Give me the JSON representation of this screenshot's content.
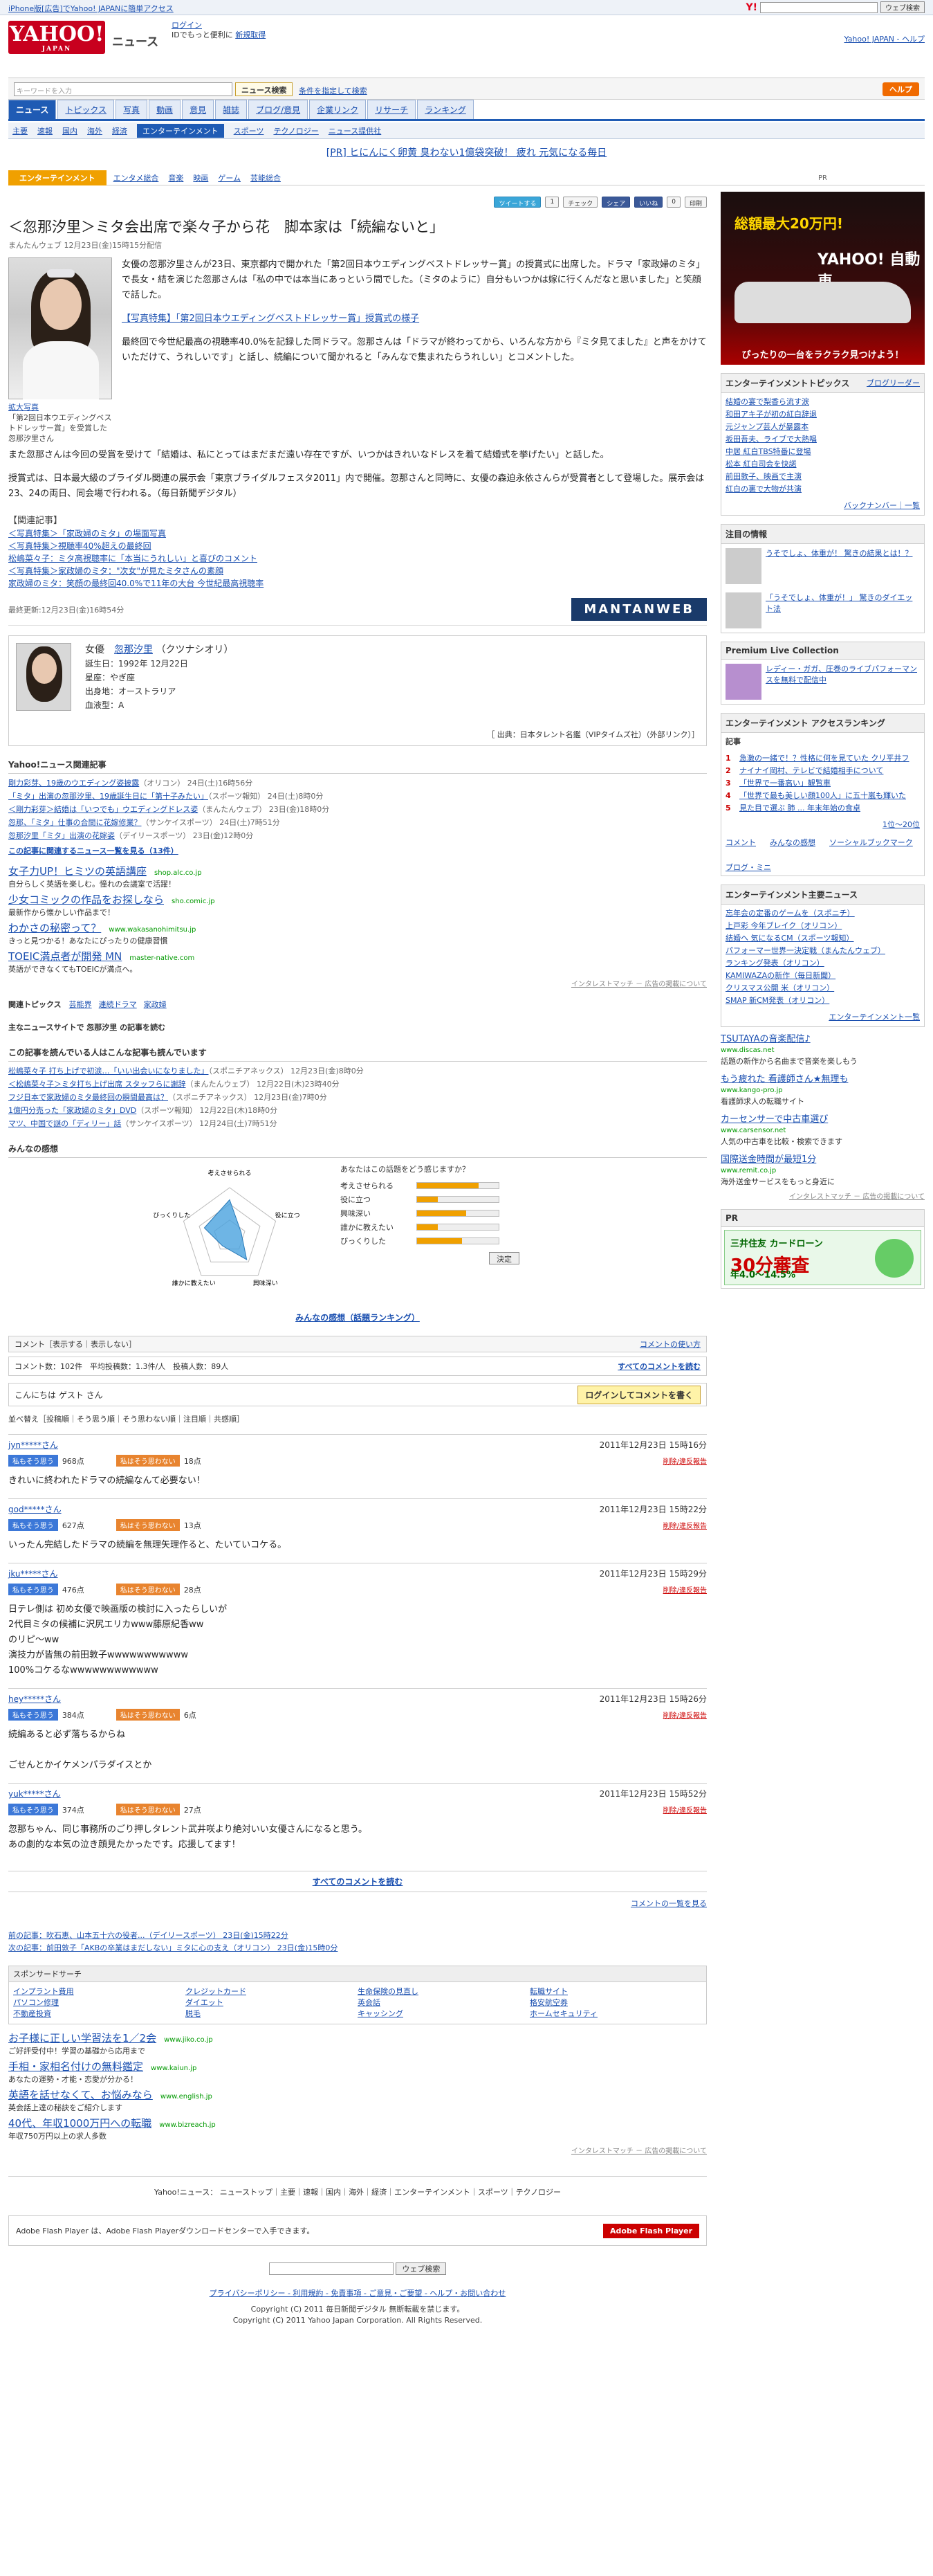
{
  "topstrip": {
    "text": "iPhone版[広告]でYahoo! JAPANに簡単アクセス",
    "search_btn": "ウェブ検索"
  },
  "masthead": {
    "logo": "YAHOO!",
    "logo_sub": "JAPAN",
    "service": "ニュース",
    "login": "ログイン",
    "login_sub": "IDでもっと便利に",
    "signup": "新規取得",
    "links": "Yahoo! JAPAN - ヘルプ"
  },
  "search": {
    "placeholder": "キーワードを入力",
    "button": "ニュース検索",
    "option": "条件を指定して検索",
    "help": "ヘルプ"
  },
  "nav1": [
    "ニュース",
    "トピックス",
    "写真",
    "動画",
    "意見",
    "雑誌",
    "ブログ/意見",
    "企業リンク",
    "リサーチ",
    "ランキング"
  ],
  "nav2": [
    "主要",
    "速報",
    "国内",
    "海外",
    "経済",
    "エンターテインメント",
    "スポーツ",
    "テクノロジー",
    "ニュース提供社"
  ],
  "pr": "[PR] ヒにんにく卵黄 臭わない1億袋突破！ 疲れ 元気になる毎日",
  "catbar": {
    "label": "エンターテインメント",
    "items": [
      "エンタメ総合",
      "音楽",
      "映画",
      "ゲーム",
      "芸能総合"
    ]
  },
  "social": {
    "tweet": "ツイートする",
    "count": "1",
    "check": "チェック",
    "share": "シェア",
    "like": "いいね",
    "count2": "0",
    "print": "印刷"
  },
  "article": {
    "headline": "＜忽那汐里＞ミタ会出席で楽々子から花　脚本家は「続編ないと」",
    "source": "まんたんウェブ 12月23日(金)15時15分配信",
    "photo_caption": "拡大写真",
    "photo_desc": "「第2回日本ウエディングベストドレッサー賞」を受賞した忽那汐里さん",
    "para1": "女優の忽那汐里さんが23日、東京都内で開かれた「第2回日本ウエディングベストドレッサー賞」の授賞式に出席した。ドラマ「家政婦のミタ」で長女・結を演じた忽那さんは「私の中では本当にあっという間でした。（ミタのように）自分もいつかは嫁に行くんだなと思いました」と笑顔で話した。",
    "link1": "【写真特集】「第2回日本ウエディングベストドレッサー賞」授賞式の様子",
    "para2": "最終回で今世紀最高の視聴率40.0%を記録した同ドラマ。忽那さんは「ドラマが終わってから、いろんな方から『ミタ見てました』と声をかけていただけて、うれしいです」と話し、続編について聞かれると「みんなで集まれたらうれしい」とコメントした。",
    "para3": "また忽那さんは今回の受賞を受けて「結婚は、私にとってはまだまだ遠い存在ですが、いつかはきれいなドレスを着て結婚式を挙げたい」と話した。",
    "para4": "授賞式は、日本最大級のブライダル関連の展示会「東京ブライダルフェスタ2011」内で開催。忽那さんと同時に、女優の森迫永依さんらが受賞者として登場した。展示会は23、24の両日、同会場で行われる。（毎日新聞デジタル）",
    "related_title": "【関連記事】",
    "related": [
      "＜写真特集＞「家政婦のミタ」の場面写真",
      "＜写真特集＞視聴率40%超えの最終回",
      "松嶋菜々子：ミタ高視聴率に「本当にうれしい」と喜びのコメント",
      "＜写真特集＞家政婦のミタ：\"次女\"が見たミタさんの素顔",
      "家政婦のミタ：笑顔の最終回40.0%で11年の大台 今世紀最高視聴率"
    ],
    "lastupd": "最終更新:12月23日(金)16時54分",
    "mantan": "MANTANWEB"
  },
  "profile": {
    "type": "女優",
    "name": "忽那汐里",
    "kana": "（クツナシオリ）",
    "birth": "誕生日：1992年 12月22日",
    "sign": "星座：やぎ座",
    "from": "出身地：オーストラリア",
    "blood": "血液型：A",
    "foot": "［ 出典：日本タレント名鑑（VIPタイムズ社）（外部リンク）］"
  },
  "yahoo_related": {
    "title": "Yahoo!ニュース関連記事",
    "items": [
      {
        "t": "剛力彩芽、19歳のウエディング姿披露",
        "d": "（オリコン） 24日(土)16時56分"
      },
      {
        "t": "「ミタ」出演の忽那汐里、19歳誕生日に「第十子みたい」",
        "d": "（スポーツ報知） 24日(土)8時0分"
      },
      {
        "t": "＜剛力彩芽＞結婚は「いつでも」ウエディングドレス姿",
        "d": "（まんたんウェブ） 23日(金)18時0分"
      },
      {
        "t": "忽那、「ミタ」仕事の合間に花嫁修業？",
        "d": "（サンケイスポーツ） 24日(土)7時51分"
      },
      {
        "t": "忽那汐里「ミタ」出演の花嫁姿",
        "d": "（デイリースポーツ） 23日(金)12時0分"
      }
    ],
    "more": "この記事に関連するニュース一覧を見る（13件）"
  },
  "ads1": [
    {
      "t": "女子力UP！ヒミツの英語講座",
      "u": "shop.alc.co.jp",
      "d": "自分らしく英語を楽しむ。憧れの会議室で活躍！"
    },
    {
      "t": "少女コミックの作品をお探しなら",
      "u": "sho.comic.jp",
      "d": "最新作から懐かしい作品まで！"
    },
    {
      "t": "わかさの秘密って？",
      "u": "www.wakasanohimitsu.jp",
      "d": "きっと見つかる！あなたにぴったりの健康習慣"
    },
    {
      "t": "TOEIC満点者が開発 MN",
      "u": "master-native.com",
      "d": "英語ができなくてもTOEICが満点へ。"
    }
  ],
  "adnote": "インタレストマッチ － 広告の掲載について",
  "topics": {
    "label": "関連トピックス",
    "items": [
      "芸能界",
      "連続ドラマ",
      "家政婦"
    ]
  },
  "mainnews": "主なニュースサイトで 忽那汐里 の記事を読む",
  "alsoread": {
    "title": "この記事を読んでいる人はこんな記事も読んでいます",
    "items": [
      {
        "t": "松嶋菜々子 打ち上げで初涙…「いい出会いになりました」",
        "d": "（スポニチアネックス） 12月23日(金)8時0分"
      },
      {
        "t": "＜松嶋菜々子＞ミタ打ち上げ出席 スタッフらに謝辞",
        "d": "（まんたんウェブ） 12月22日(木)23時40分"
      },
      {
        "t": "フジ日本で家政婦のミタ最終回の瞬間最高は？",
        "d": "（スポニチアネックス） 12月23日(金)7時0分"
      },
      {
        "t": "1億円分売った「家政婦のミタ」DVD",
        "d": "（スポーツ報知） 12月22日(木)18時0分"
      },
      {
        "t": "マツ、中国で謎の「ディリー」話",
        "d": "（サンケイスポーツ） 12月24日(土)7時51分"
      }
    ]
  },
  "vote": {
    "title": "みんなの感想",
    "q": "あなたはこの話題をどう感じますか？",
    "axes": [
      "考えさせられる",
      "役に立つ",
      "興味深い",
      "誰かに教えたい",
      "びっくりした"
    ],
    "vals": [
      0.75,
      0.25,
      0.6,
      0.25,
      0.55
    ],
    "btn": "決定",
    "more": "みんなの感想（話題ランキング）"
  },
  "comments": {
    "bar_l": "コメント［表示する｜表示しない］",
    "bar_r": "コメントの使い方",
    "stat": "コメント数：102件　平均投稿数：1.3件/人　投稿人数：89人",
    "stat_r": "すべてのコメントを読む",
    "guest": "こんにちは ゲスト さん",
    "login": "ログインしてコメントを書く",
    "sort": "並べ替え［投稿順｜そう思う順｜そう思わない順｜注目順｜共感順］",
    "list": [
      {
        "u": "jyn*****さん",
        "d": "2011年12月23日 15時16分",
        "p": "968点",
        "n": "18点",
        "b": "きれいに終われたドラマの続編なんて必要ない！"
      },
      {
        "u": "god*****さん",
        "d": "2011年12月23日 15時22分",
        "p": "627点",
        "n": "13点",
        "b": "いったん完結したドラマの続編を無理矢理作ると、たいていコケる。"
      },
      {
        "u": "jku*****さん",
        "d": "2011年12月23日 15時29分",
        "p": "476点",
        "n": "28点",
        "b": "日テレ側は 初め女優で映画版の検討に入ったらしいが\n2代目ミタの候補に沢尻エリカwww藤原紀香ww\nのリピ〜ww\n演技力が皆無の前田敦子wwwwwwwwwww\n100%コケるなwwwwwwwwwwww"
      },
      {
        "u": "hey*****さん",
        "d": "2011年12月23日 15時26分",
        "p": "384点",
        "n": "6点",
        "b": "続編あると必ず落ちるからね\n\nごせんとかイケメンパラダイスとか"
      },
      {
        "u": "yuk*****さん",
        "d": "2011年12月23日 15時52分",
        "p": "374点",
        "n": "27点",
        "b": "忽那ちゃん、同じ事務所のごり押しタレント武井咲より絶対いい女優さんになると思う。\nあの劇的な本気の泣き顔見たかったです。応援してます！"
      }
    ],
    "vp": "私もそう思う",
    "vn": "私はそう思わない",
    "rp": "削除/違反報告",
    "all": "すべてのコメントを読む",
    "more": "コメントの一覧を見る"
  },
  "prevnext": {
    "prev": "前の記事：吹石恵、山本五十六の役者...（デイリースポーツ） 23日(金)15時22分",
    "next": "次の記事：前田敦子「AKBの卒業はまだしない」ミタに心の支え（オリコン） 23日(金)15時0分"
  },
  "sponsor": {
    "title": "スポンサードサーチ",
    "items": [
      "インプラント費用",
      "クレジットカード",
      "生命保険の見直し",
      "転職サイト",
      "パソコン修理",
      "ダイエット",
      "英会話",
      "格安航空券",
      "不動産投資",
      "脱毛",
      "キャッシング",
      "ホームセキュリティ"
    ]
  },
  "ads2": [
    {
      "t": "お子様に正しい学習法を1／2会",
      "u": "www.jiko.co.jp",
      "d": "ご好評受付中！学習の基礎から応用まで"
    },
    {
      "t": "手相・家相名付けの無料鑑定",
      "u": "www.kaiun.jp",
      "d": "あなたの運勢・才能・恋愛が分かる！"
    },
    {
      "t": "英語を話せなくて、お悩みなら",
      "u": "www.english.jp",
      "d": "英会話上達の秘訣をご紹介します"
    },
    {
      "t": "40代、年収1000万円への転職",
      "u": "www.bizreach.jp",
      "d": "年収750万円以上の求人多数"
    }
  ],
  "footnav": "Yahoo!ニュース： ニューストップ｜主要｜速報｜国内｜海外｜経済｜エンターテインメント｜スポーツ｜テクノロジー",
  "flash": {
    "text": "Adobe Flash Player は、Adobe Flash Playerダウンロードセンターで入手できます。",
    "btn": "Adobe Flash Player"
  },
  "btmsearch": "ウェブ検索",
  "footlinks": "プライバシーポリシー - 利用規約 - 免責事項 - ご意見・ご要望 - ヘルプ・お問い合わせ",
  "copy1": "Copyright (C) 2011 毎日新聞デジタル 無断転載を禁じます。",
  "copy2": "Copyright (C) 2011 Yahoo Japan Corporation. All Rights Reserved.",
  "right": {
    "pr": "PR",
    "ad_t1": "総額最大20万円!",
    "ad_t2": "YAHOO! 自動車",
    "ad_t3": "ぴったりの一台をラクラク見つけよう！",
    "topics_title": "エンターテインメントトピックス",
    "topics_link": "ブログリーダー",
    "topics": [
      "結婚の宴で梨香ら流す涙",
      "和田アキ子が初の紅白辞退",
      "元ジャンプ芸人が暴露本",
      "坂田吾夫、ライブで大熱唱",
      "中居 紅白TBS特番に登場",
      "松本 紅白司会を快諾",
      "前田敦子、映画で主演",
      "紅白の裏で大物が共演"
    ],
    "topics_foot": "バックナンバー｜一覧",
    "attn_title": "注目の情報",
    "attn1": "うそでしょ、体重が！ 驚きの結果とは！？",
    "attn2": "「うそでしょ、体重が！」 驚きのダイエット法",
    "plc_title": "Premium Live Collection",
    "plc_desc": "レディー・ガガ、圧巻のライブパフォーマンスを無料で配信中",
    "rank_title": "エンターテインメント アクセスランキング",
    "rank_tab": "記事",
    "rank": [
      "急激の一緒で！？性格に何を見ていた クリ平井フ",
      "ナイナイ岡村、テレビで結婚相手について",
      "「世界で一番高い」観覧車",
      "「世界で最も美しい顔100人」に五十嵐も輝いた",
      "見た目で選ぶ 肺 ... 年末年始の食卓"
    ],
    "rank_more": "1位〜20位",
    "rank_tabs": [
      "コメント",
      "みんなの感想",
      "ソーシャルブックマーク",
      "ブログ・ミニ"
    ],
    "main_title": "エンターテインメント主要ニュース",
    "main": [
      "忘年会の定番のゲームを（スポニチ）",
      "上戸彩 今年ブレイク（オリコン）",
      "結婚へ 気になるCM（スポーツ報知）",
      "パフォーマー世界一決定戦（まんたんウェブ）",
      "ランキング発表（オリコン）",
      "KAMIWAZAの新作（毎日新聞）",
      "クリスマス公開 米（オリコン）",
      "SMAP 新CM発表（オリコン）"
    ],
    "main_foot": "エンターテインメント一覧",
    "rads": [
      {
        "t": "TSUTAYAの音楽配信♪",
        "u": "www.discas.net",
        "d": "話題の新作から名曲まで音楽を楽しもう"
      },
      {
        "t": "もう疲れた 看護師さん★無理も",
        "u": "www.kango-pro.jp",
        "d": "看護師求人の転職サイト"
      },
      {
        "t": "カーセンサーで中古車選び",
        "u": "www.carsensor.net",
        "d": "人気の中古車を比較・検索できます"
      },
      {
        "t": "国際送金時間が最短1分",
        "u": "www.remit.co.jp",
        "d": "海外送金サービスをもっと身近に"
      }
    ],
    "rad_note": "インタレストマッチ － 広告の掲載について",
    "card_pr": "PR",
    "card1": "三井住友 カードローン",
    "card2": "30分審査",
    "card3": "年4.0〜14.5%"
  }
}
